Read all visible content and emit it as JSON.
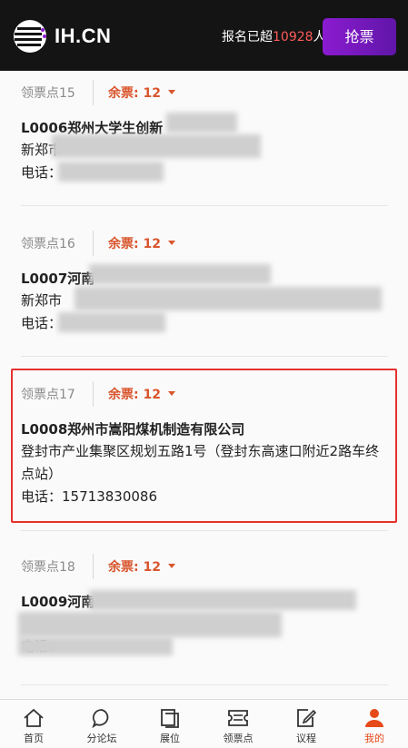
{
  "header": {
    "logo_text": "IH.CN",
    "signup_prefix": "报名已超",
    "signup_count": "10928",
    "signup_suffix": "人",
    "grab_button": "抢票"
  },
  "cards": [
    {
      "point": "领票点15",
      "remaining": "余票: 12",
      "org": "L0006郑州大学生创新",
      "address": "新郑市",
      "phone_label": "电话："
    },
    {
      "point": "领票点16",
      "remaining": "余票: 12",
      "org": "L0007河南",
      "address": "新郑市",
      "phone_label": "电话："
    },
    {
      "point": "领票点17",
      "remaining": "余票: 12",
      "org": "L0008郑州市嵩阳煤机制造有限公司",
      "address": "登封市产业集聚区规划五路1号（登封东高速口附近2路车终点站）",
      "phone_label": "电话：",
      "phone": "15713830086"
    },
    {
      "point": "领票点18",
      "remaining": "余票: 12",
      "org": "L0009河南",
      "address": "",
      "phone_label": "电话："
    }
  ],
  "tabs": [
    {
      "label": "首页",
      "icon": "home-icon"
    },
    {
      "label": "分论坛",
      "icon": "forum-icon"
    },
    {
      "label": "展位",
      "icon": "booth-icon"
    },
    {
      "label": "领票点",
      "icon": "ticket-icon"
    },
    {
      "label": "议程",
      "icon": "agenda-icon"
    },
    {
      "label": "我的",
      "icon": "user-icon"
    }
  ],
  "colors": {
    "header_bg": "#141414",
    "accent_purple": "#7a1bc4",
    "remain_orange": "#d9552d",
    "highlight_red": "#e5322d",
    "active_tab": "#e64a19"
  }
}
